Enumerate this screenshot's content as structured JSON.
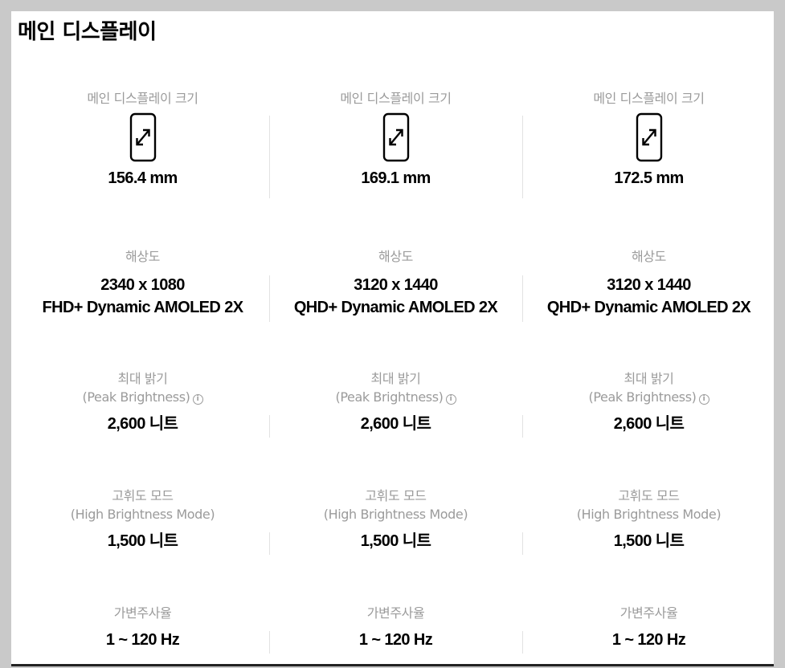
{
  "page_title": "메인 디스플레이",
  "rows": [
    {
      "cells": [
        {
          "label": "메인 디스플레이 크기",
          "value": "156.4 mm"
        },
        {
          "label": "메인 디스플레이 크기",
          "value": "169.1 mm"
        },
        {
          "label": "메인 디스플레이 크기",
          "value": "172.5 mm"
        }
      ],
      "icon": "phone-diagonal-size-icon"
    },
    {
      "cells": [
        {
          "label": "해상도",
          "value_line1": "2340 x 1080",
          "value_line2": "FHD+ Dynamic AMOLED 2X"
        },
        {
          "label": "해상도",
          "value_line1": "3120 x 1440",
          "value_line2": "QHD+ Dynamic AMOLED 2X"
        },
        {
          "label": "해상도",
          "value_line1": "3120 x 1440",
          "value_line2": "QHD+ Dynamic AMOLED 2X"
        }
      ]
    },
    {
      "cells": [
        {
          "label_line1": "최대 밝기",
          "label_line2": "(Peak Brightness)",
          "info": "i",
          "value": "2,600 니트"
        },
        {
          "label_line1": "최대 밝기",
          "label_line2": "(Peak Brightness)",
          "info": "i",
          "value": "2,600 니트"
        },
        {
          "label_line1": "최대 밝기",
          "label_line2": "(Peak Brightness)",
          "info": "i",
          "value": "2,600 니트"
        }
      ]
    },
    {
      "cells": [
        {
          "label_line1": "고휘도 모드",
          "label_line2": "(High Brightness Mode)",
          "value": "1,500 니트"
        },
        {
          "label_line1": "고휘도 모드",
          "label_line2": "(High Brightness Mode)",
          "value": "1,500 니트"
        },
        {
          "label_line1": "고휘도 모드",
          "label_line2": "(High Brightness Mode)",
          "value": "1,500 니트"
        }
      ]
    },
    {
      "cells": [
        {
          "label": "가변주사율",
          "value": "1 ~ 120 Hz"
        },
        {
          "label": "가변주사율",
          "value": "1 ~ 120 Hz"
        },
        {
          "label": "가변주사율",
          "value": "1 ~ 120 Hz"
        }
      ]
    }
  ],
  "colors": {
    "label": "#9b9b9b",
    "value": "#000000",
    "divider": "#e2e2e2",
    "frame": "#c9c9c9"
  }
}
